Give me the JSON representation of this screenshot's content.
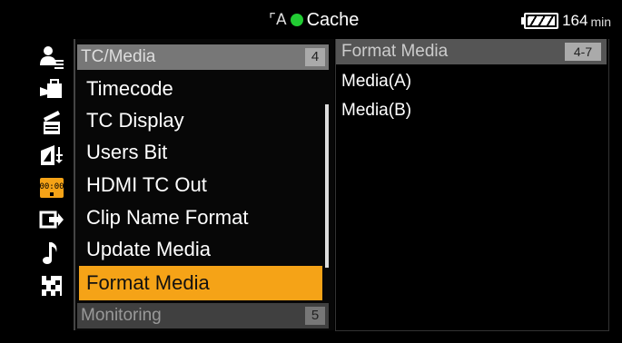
{
  "status": {
    "relay_icon": "relay-icon",
    "cache_label": "Cache",
    "battery_value": "164",
    "battery_unit": "min",
    "rec_color": "#22cc33"
  },
  "categories": [
    {
      "icon": "user-menu-icon",
      "selected": false
    },
    {
      "icon": "camera-icon",
      "selected": false
    },
    {
      "icon": "clapperboard-icon",
      "selected": false
    },
    {
      "icon": "exposure-icon",
      "selected": false
    },
    {
      "icon": "tc-media-icon",
      "selected": true,
      "label": "00:00"
    },
    {
      "icon": "output-icon",
      "selected": false
    },
    {
      "icon": "audio-note-icon",
      "selected": false
    },
    {
      "icon": "setup-grid-icon",
      "selected": false
    }
  ],
  "menu": {
    "section": {
      "title": "TC/Media",
      "number": "4"
    },
    "items": [
      {
        "label": "Timecode"
      },
      {
        "label": "TC Display"
      },
      {
        "label": "Users Bit"
      },
      {
        "label": "HDMI TC Out"
      },
      {
        "label": "Clip Name Format"
      },
      {
        "label": "Update Media"
      },
      {
        "label": "Format Media",
        "selected": true
      }
    ],
    "next_section": {
      "title": "Monitoring",
      "number": "5"
    }
  },
  "detail": {
    "title": "Format Media",
    "range": "4-7",
    "options": [
      "Media(A)",
      "Media(B)"
    ]
  },
  "colors": {
    "accent": "#f5a317",
    "header": "#777777"
  }
}
